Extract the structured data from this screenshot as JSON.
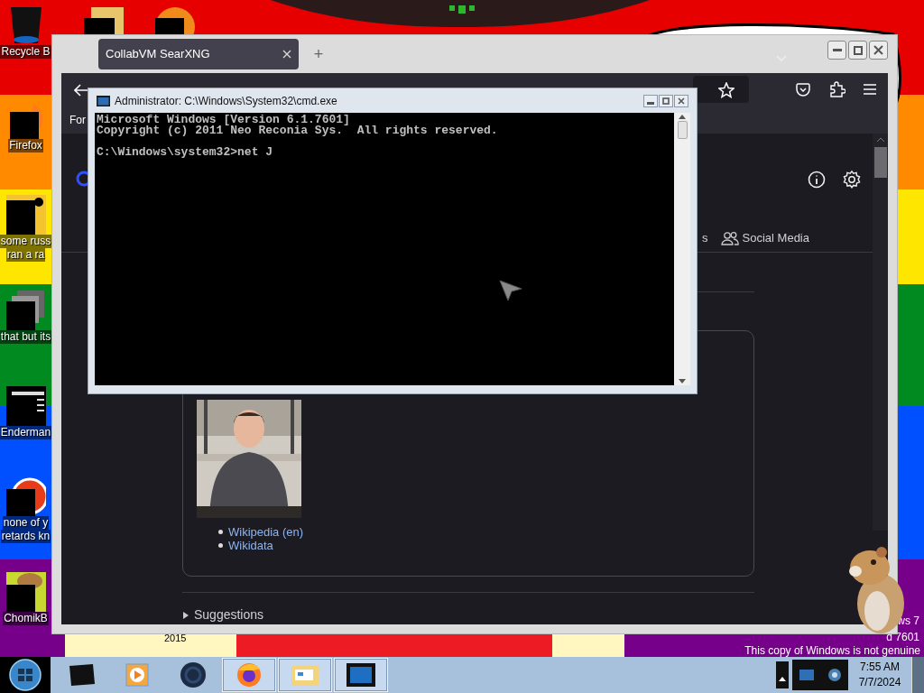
{
  "desktop": {
    "icons": [
      {
        "kind": "bin",
        "lines": [
          "Recycle B"
        ]
      },
      {
        "kind": "fire",
        "lines": [
          "Firefox"
        ]
      },
      {
        "kind": "doc",
        "lines": [
          "some russ",
          "ran a ra"
        ]
      },
      {
        "kind": "stack",
        "lines": [
          "that but its"
        ]
      },
      {
        "kind": "term",
        "lines": [
          "Enderman"
        ]
      },
      {
        "kind": "ring",
        "lines": [
          "none of y",
          "retards kn"
        ]
      },
      {
        "kind": "rodent",
        "lines": [
          "ChomikB"
        ]
      }
    ],
    "year": "2015",
    "edition": "ws 7",
    "build": "d 7601",
    "notice": "This copy of Windows is not genuine"
  },
  "browser": {
    "tabs": [
      {
        "title": "CollabVM SearXNG",
        "selected": true
      }
    ],
    "new_tab": "+",
    "bookmark": "For",
    "categories": [
      {
        "label": "s",
        "icon": false
      },
      {
        "label": "Social Media",
        "icon": true
      }
    ],
    "links": [
      "Wikipedia (en)",
      "Wikidata"
    ],
    "suggestions": {
      "label": "Suggestions",
      "expanded": false
    }
  },
  "cmd": {
    "title": "Administrator: C:\\Windows\\System32\\cmd.exe",
    "blocks": [
      [
        "Microsoft Windows [Version 6.1.7601]",
        "Copyright (c) 2011 Neo Reconia Sys.  All rights reserved."
      ],
      [
        "C:\\Windows\\system32>net J"
      ]
    ]
  },
  "taskbar": {
    "apps": [
      {
        "kind": "box",
        "running": false
      },
      {
        "kind": "media",
        "running": false
      },
      {
        "kind": "globe",
        "running": false
      },
      {
        "kind": "firefox",
        "running": true
      },
      {
        "kind": "explorer",
        "running": true
      },
      {
        "kind": "console",
        "running": true
      }
    ],
    "clock": {
      "time": "7:55 AM",
      "date": "7/7/2024"
    }
  }
}
